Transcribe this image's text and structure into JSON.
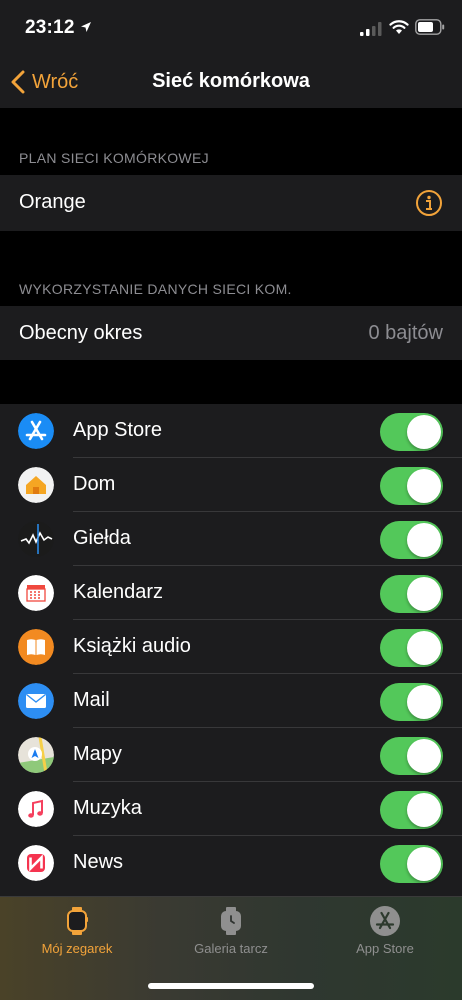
{
  "status_bar": {
    "time": "23:12"
  },
  "nav": {
    "back_label": "Wróć",
    "title": "Sieć komórkowa"
  },
  "plan_section": {
    "header": "PLAN SIECI KOMÓRKOWEJ",
    "carrier": "Orange"
  },
  "usage_section": {
    "header": "WYKORZYSTANIE DANYCH SIECI KOM.",
    "period_label": "Obecny okres",
    "period_value": "0 bajtów"
  },
  "apps": [
    {
      "name": "App Store",
      "icon": "app-store-icon",
      "enabled": true
    },
    {
      "name": "Dom",
      "icon": "home-icon",
      "enabled": true
    },
    {
      "name": "Giełda",
      "icon": "stocks-icon",
      "enabled": true
    },
    {
      "name": "Kalendarz",
      "icon": "calendar-icon",
      "enabled": true
    },
    {
      "name": "Książki audio",
      "icon": "audiobooks-icon",
      "enabled": true
    },
    {
      "name": "Mail",
      "icon": "mail-icon",
      "enabled": true
    },
    {
      "name": "Mapy",
      "icon": "maps-icon",
      "enabled": true
    },
    {
      "name": "Muzyka",
      "icon": "music-icon",
      "enabled": true
    },
    {
      "name": "News",
      "icon": "news-icon",
      "enabled": true
    }
  ],
  "tabbar": {
    "tabs": [
      {
        "label": "Mój zegarek",
        "icon": "watch-icon",
        "active": true
      },
      {
        "label": "Galeria tarcz",
        "icon": "face-gallery-icon",
        "active": false
      },
      {
        "label": "App Store",
        "icon": "app-store-icon",
        "active": false
      }
    ]
  },
  "colors": {
    "accent": "#f2a33a",
    "toggle_on": "#53c85a",
    "cell_bg": "#1c1c1e"
  }
}
